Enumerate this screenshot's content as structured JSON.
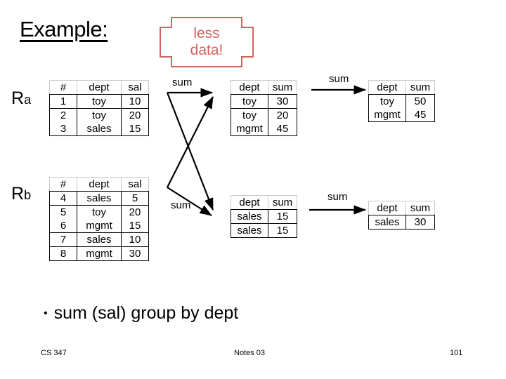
{
  "slide": {
    "title": "Example:",
    "callout": {
      "line1": "less",
      "line2": "data!",
      "color": "#d1625f"
    },
    "bullet": {
      "marker": "•",
      "text": "sum (sal)  group by dept"
    }
  },
  "relations": {
    "ra_label": "R",
    "ra_sub": "a",
    "rb_label": "R",
    "rb_sub": "b"
  },
  "arrow_labels": {
    "sum_top": "sum",
    "sum_bottom": "sum",
    "sum_ra_final": "sum",
    "sum_rb_final": "sum"
  },
  "tables": {
    "ra": {
      "headers": [
        "#",
        "dept",
        "sal"
      ],
      "rows": [
        [
          "1",
          "toy",
          "10"
        ],
        [
          "2",
          "toy",
          "20"
        ],
        [
          "3",
          "sales",
          "15"
        ]
      ]
    },
    "ra_mid": {
      "headers": [
        "dept",
        "sum"
      ],
      "rows": [
        [
          "toy",
          "30"
        ],
        [
          "toy",
          "20"
        ],
        [
          "mgmt",
          "45"
        ]
      ]
    },
    "ra_final": {
      "headers": [
        "dept",
        "sum"
      ],
      "rows": [
        [
          "toy",
          "50"
        ],
        [
          "mgmt",
          "45"
        ]
      ]
    },
    "rb": {
      "headers": [
        "#",
        "dept",
        "sal"
      ],
      "rows": [
        [
          "4",
          "sales",
          "5"
        ],
        [
          "5",
          "toy",
          "20"
        ],
        [
          "6",
          "mgmt",
          "15"
        ],
        [
          "7",
          "sales",
          "10"
        ],
        [
          "8",
          "mgmt",
          "30"
        ]
      ]
    },
    "rb_mid": {
      "headers": [
        "dept",
        "sum"
      ],
      "rows": [
        [
          "sales",
          "15"
        ],
        [
          "sales",
          "15"
        ]
      ]
    },
    "rb_final": {
      "headers": [
        "dept",
        "sum"
      ],
      "rows": [
        [
          "sales",
          "30"
        ]
      ]
    }
  },
  "footer": {
    "left": "CS 347",
    "center": "Notes 03",
    "right": "101"
  }
}
